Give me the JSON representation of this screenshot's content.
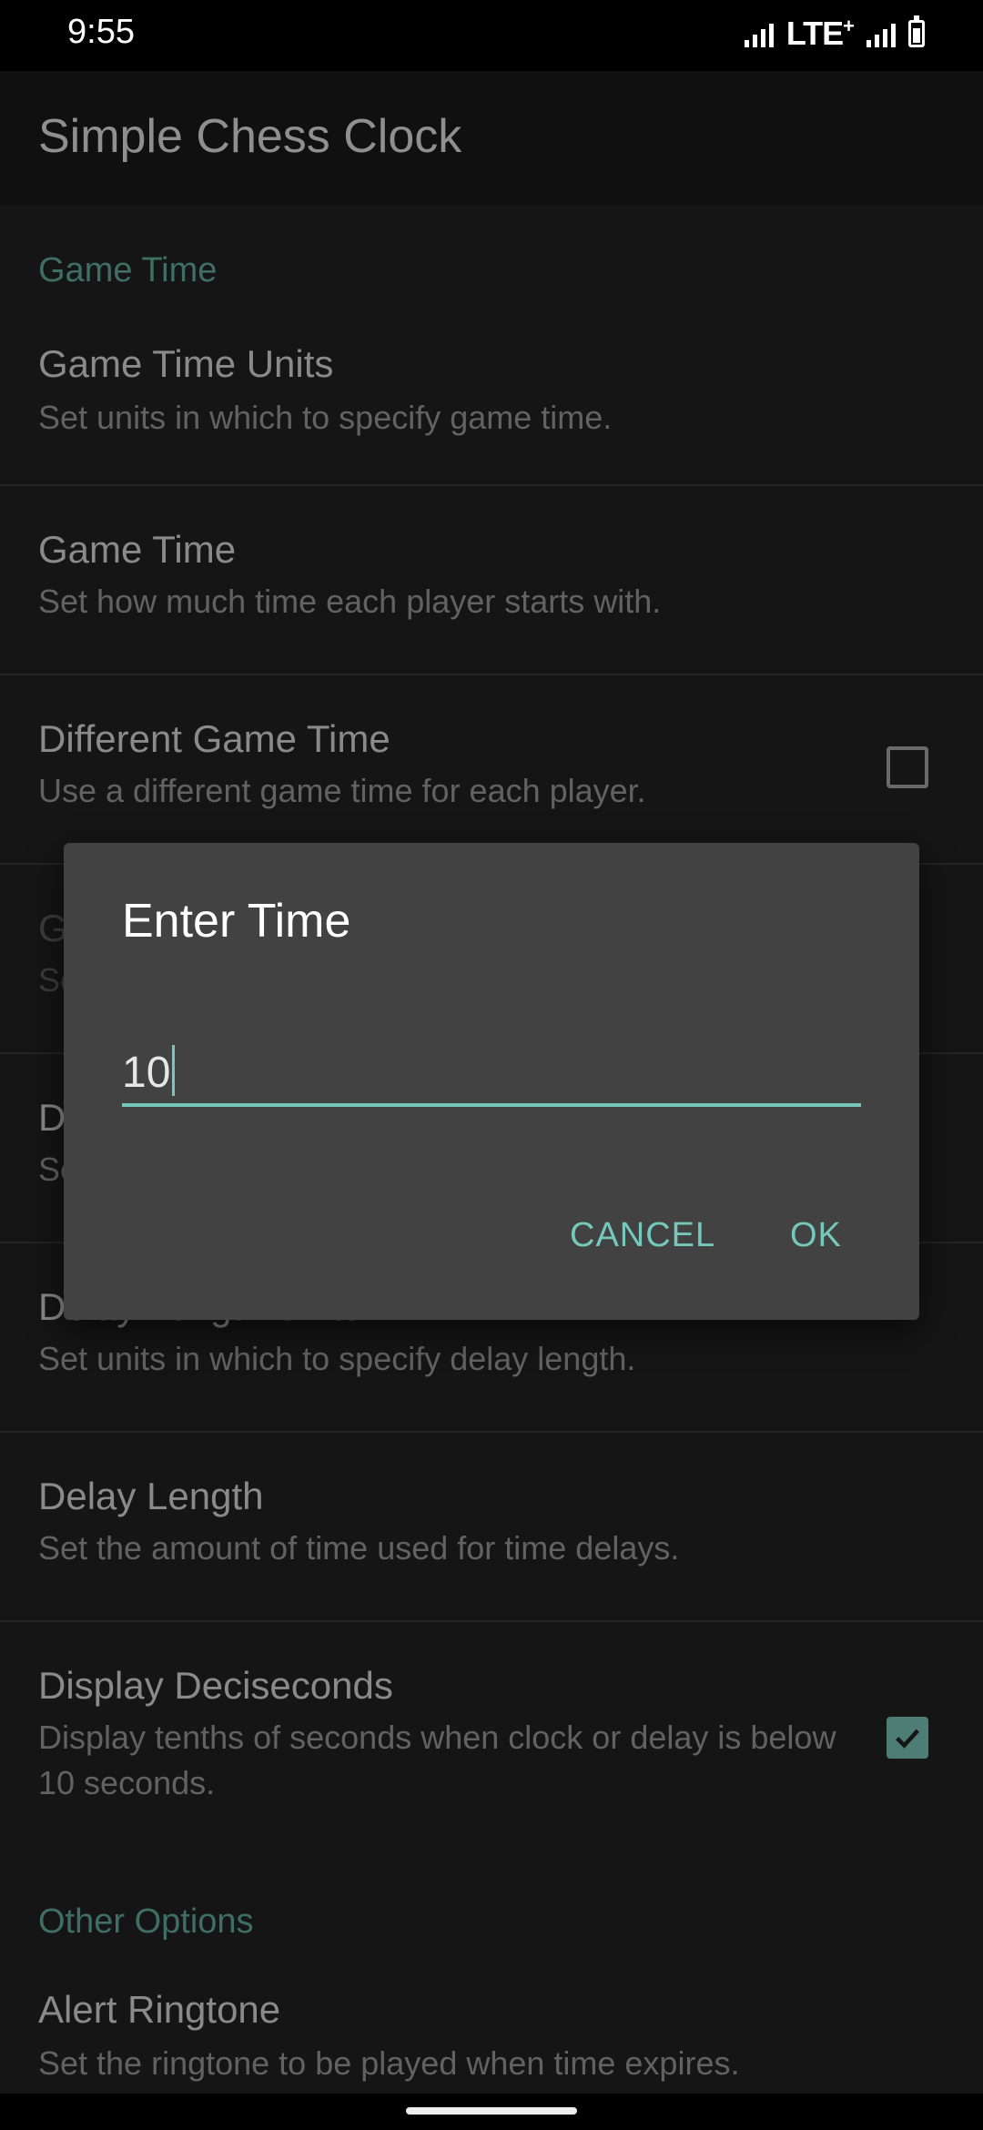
{
  "status_bar": {
    "time": "9:55",
    "network": "LTE",
    "network_sup": "+"
  },
  "app_bar": {
    "title": "Simple Chess Clock"
  },
  "settings": {
    "category_game_time": "Game Time",
    "game_time_units": {
      "title": "Game Time Units",
      "summary": "Set units in which to specify game time."
    },
    "game_time": {
      "title": "Game Time",
      "summary": "Set how much time each player starts with."
    },
    "different_game_time": {
      "title": "Different Game Time",
      "summary": "Use a different game time for each player.",
      "checked": false
    },
    "hidden_row_1": {
      "title": "G",
      "summary": "Se"
    },
    "hidden_row_2": {
      "title": "D",
      "summary": "Se"
    },
    "delay_length_units": {
      "title": "Delay Length Units",
      "summary": "Set units in which to specify delay length."
    },
    "delay_length": {
      "title": "Delay Length",
      "summary": "Set the amount of time used for time delays."
    },
    "display_deciseconds": {
      "title": "Display Deciseconds",
      "summary": "Display tenths of seconds when clock or delay is below 10 seconds.",
      "checked": true
    },
    "category_other": "Other Options",
    "alert_ringtone": {
      "title": "Alert Ringtone",
      "summary": "Set the ringtone to be played when time expires."
    }
  },
  "dialog": {
    "title": "Enter Time",
    "input_value": "10",
    "cancel_label": "CANCEL",
    "ok_label": "OK"
  },
  "colors": {
    "accent": "#76c8bd",
    "category": "#3f6e63",
    "dialog_bg": "#424242",
    "screen_bg": "#151515"
  }
}
